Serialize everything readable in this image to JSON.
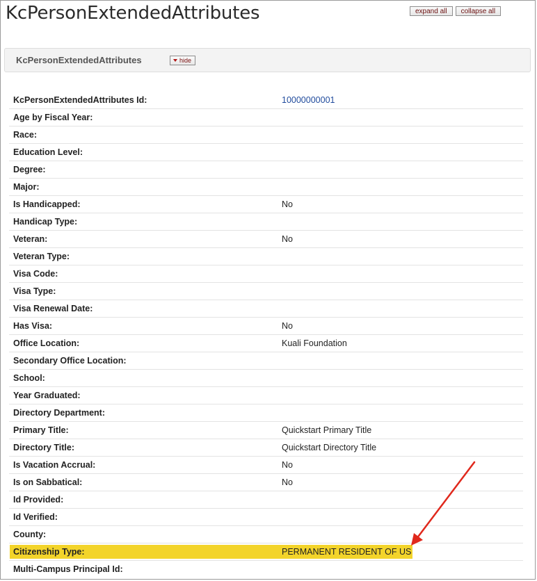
{
  "page": {
    "title": "KcPersonExtendedAttributes"
  },
  "toolbar": {
    "expand_all_label": "expand all",
    "collapse_all_label": "collapse all"
  },
  "section": {
    "title": "KcPersonExtendedAttributes",
    "hide_label": "hide"
  },
  "rows": [
    {
      "label": "KcPersonExtendedAttributes Id:",
      "value": "10000000001"
    },
    {
      "label": "Age by Fiscal Year:",
      "value": ""
    },
    {
      "label": "Race:",
      "value": ""
    },
    {
      "label": "Education Level:",
      "value": ""
    },
    {
      "label": "Degree:",
      "value": ""
    },
    {
      "label": "Major:",
      "value": ""
    },
    {
      "label": "Is Handicapped:",
      "value": "No"
    },
    {
      "label": "Handicap Type:",
      "value": ""
    },
    {
      "label": "Veteran:",
      "value": "No"
    },
    {
      "label": "Veteran Type:",
      "value": ""
    },
    {
      "label": "Visa Code:",
      "value": ""
    },
    {
      "label": "Visa Type:",
      "value": ""
    },
    {
      "label": "Visa Renewal Date:",
      "value": ""
    },
    {
      "label": "Has Visa:",
      "value": "No"
    },
    {
      "label": "Office Location:",
      "value": "Kuali Foundation"
    },
    {
      "label": "Secondary Office Location:",
      "value": ""
    },
    {
      "label": "School:",
      "value": ""
    },
    {
      "label": "Year Graduated:",
      "value": ""
    },
    {
      "label": "Directory Department:",
      "value": ""
    },
    {
      "label": "Primary Title:",
      "value": "Quickstart Primary Title"
    },
    {
      "label": "Directory Title:",
      "value": "Quickstart Directory Title"
    },
    {
      "label": "Is Vacation Accrual:",
      "value": "No"
    },
    {
      "label": "Is on Sabbatical:",
      "value": "No"
    },
    {
      "label": "Id Provided:",
      "value": ""
    },
    {
      "label": "Id Verified:",
      "value": ""
    },
    {
      "label": "County:",
      "value": ""
    },
    {
      "label": "Citizenship Type:",
      "value": "PERMANENT RESIDENT OF US",
      "highlight": true
    },
    {
      "label": "Multi-Campus Principal Id:",
      "value": ""
    }
  ],
  "colors": {
    "highlight": "#f3d42a",
    "annotation_arrow": "#e0281c",
    "link": "#1f4a9c"
  }
}
